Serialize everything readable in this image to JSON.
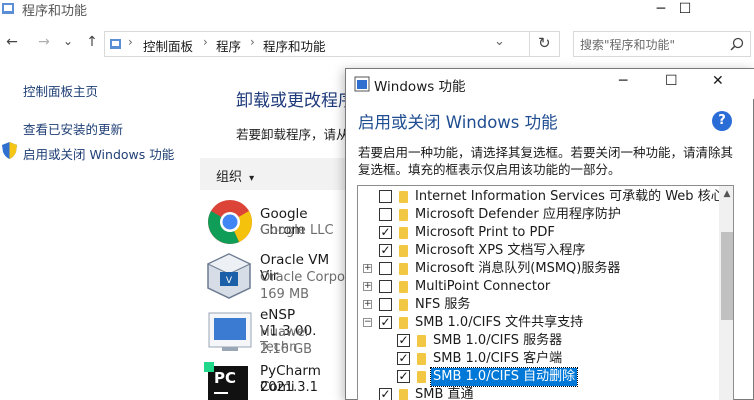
{
  "control_panel": {
    "title": "程序和功能",
    "window_buttons": {
      "minimize": "─",
      "maximize": "☐"
    },
    "nav": {
      "back": "←",
      "forward": "→",
      "recent": "⌄",
      "up": "↑",
      "refresh": "↻"
    },
    "breadcrumb": [
      "控制面板",
      "程序",
      "程序和功能"
    ],
    "breadcrumb_sep": "›",
    "search_placeholder": "搜索\"程序和功能\"",
    "left_nav": {
      "home": "控制面板主页",
      "view_updates": "查看已安装的更新",
      "toggle_features": "启用或关闭 Windows 功能"
    },
    "main_title": "卸载或更改程序",
    "main_desc": "若要卸载程序，请从",
    "organize": "组织",
    "organize_arrow": "▾",
    "programs": [
      {
        "name": "Google Chrom",
        "publisher": "Google LLC",
        "size": ""
      },
      {
        "name": "Oracle VM Vir",
        "publisher": "Oracle Corpo",
        "size": "169 MB"
      },
      {
        "name": "eNSP V1.3.00.",
        "publisher": "Huawei Techn",
        "size": "2.16 GB"
      },
      {
        "name": "PyCharm Comi",
        "publisher": "2021.3.1",
        "size": ""
      }
    ],
    "pycharm_logo": "PC"
  },
  "dialog": {
    "title": "Windows 功能",
    "buttons": {
      "minimize": "─",
      "maximize": "☐",
      "close": "✕"
    },
    "heading": "启用或关闭 Windows 功能",
    "help": "?",
    "description": "若要启用一种功能，请选择其复选框。若要关闭一种功能，请清除其复选框。填充的框表示仅启用该功能的一部分。",
    "features": [
      {
        "label": "Internet Information Services 可承载的 Web 核心",
        "state": "unchecked",
        "expander": "",
        "level": 0
      },
      {
        "label": "Microsoft Defender 应用程序防护",
        "state": "unchecked",
        "expander": "",
        "level": 0
      },
      {
        "label": "Microsoft Print to PDF",
        "state": "checked",
        "expander": "",
        "level": 0
      },
      {
        "label": "Microsoft XPS 文档写入程序",
        "state": "checked",
        "expander": "",
        "level": 0
      },
      {
        "label": "Microsoft 消息队列(MSMQ)服务器",
        "state": "unchecked",
        "expander": "+",
        "level": 0
      },
      {
        "label": "MultiPoint Connector",
        "state": "unchecked",
        "expander": "+",
        "level": 0
      },
      {
        "label": "NFS 服务",
        "state": "unchecked",
        "expander": "+",
        "level": 0
      },
      {
        "label": "SMB 1.0/CIFS 文件共享支持",
        "state": "checked",
        "expander": "−",
        "level": 0
      },
      {
        "label": "SMB 1.0/CIFS 服务器",
        "state": "checked",
        "expander": "",
        "level": 1
      },
      {
        "label": "SMB 1.0/CIFS 客户端",
        "state": "checked",
        "expander": "",
        "level": 1
      },
      {
        "label": "SMB 1.0/CIFS 自动删除",
        "state": "checked",
        "expander": "",
        "level": 1,
        "selected": true
      },
      {
        "label": "SMB 直通",
        "state": "checked",
        "expander": "",
        "level": 0
      }
    ],
    "scroll_up": "▲"
  },
  "colors": {
    "heading_blue": "#1f4d91",
    "link_blue": "#1f3f75",
    "selection": "#0078d7",
    "folder": "#f2c744"
  }
}
